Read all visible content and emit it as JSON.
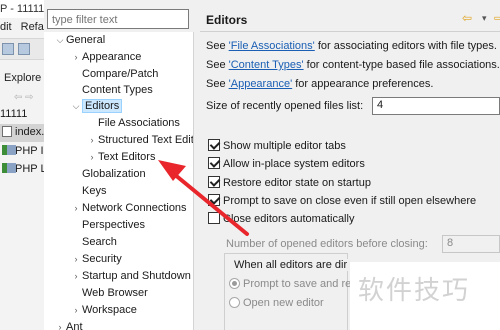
{
  "ide": {
    "title_fragment": "P - 11111",
    "menu": [
      "dit",
      "Refa"
    ],
    "explorer_tab": "Explore",
    "project": "11111",
    "files": [
      "index.",
      "PHP In",
      "PHP L"
    ]
  },
  "preferences": {
    "filter_placeholder": "type filter text",
    "tree": {
      "ant": "Ant",
      "general": "General",
      "general_children": [
        {
          "label": "Appearance",
          "expandable": true
        },
        {
          "label": "Compare/Patch",
          "expandable": false
        },
        {
          "label": "Content Types",
          "expandable": false
        },
        {
          "label": "Editors",
          "expandable": true,
          "expanded": true,
          "selected": true
        },
        {
          "label": "Globalization",
          "expandable": false
        },
        {
          "label": "Keys",
          "expandable": false
        },
        {
          "label": "Network Connections",
          "expandable": true
        },
        {
          "label": "Perspectives",
          "expandable": false
        },
        {
          "label": "Search",
          "expandable": false
        },
        {
          "label": "Security",
          "expandable": true
        },
        {
          "label": "Startup and Shutdown",
          "expandable": true
        },
        {
          "label": "Web Browser",
          "expandable": false
        },
        {
          "label": "Workspace",
          "expandable": true
        }
      ],
      "editors_children": [
        {
          "label": "File Associations",
          "expandable": false
        },
        {
          "label": "Structured Text Editors",
          "expandable": true
        },
        {
          "label": "Text Editors",
          "expandable": true
        }
      ]
    },
    "page": {
      "title": "Editors",
      "see_lines": [
        {
          "prefix": "See ",
          "link": "'File Associations'",
          "suffix": " for associating editors with file types."
        },
        {
          "prefix": "See ",
          "link": "'Content Types'",
          "suffix": " for content-type based file associations."
        },
        {
          "prefix": "See ",
          "link": "'Appearance'",
          "suffix": " for appearance preferences."
        }
      ],
      "recent_files_label": "Size of recently opened files list:",
      "recent_files_value": "4",
      "checkboxes": [
        {
          "label": "Show multiple editor tabs",
          "checked": true
        },
        {
          "label": "Allow in-place system editors",
          "checked": true
        },
        {
          "label": "Restore editor state on startup",
          "checked": true
        },
        {
          "label": "Prompt to save on close even if still open elsewhere",
          "checked": true
        },
        {
          "label": "Close editors automatically",
          "checked": false
        }
      ],
      "opened_editors_label": "Number of opened editors before closing:",
      "opened_editors_value": "8",
      "group_title": "When all editors are dir",
      "radios": [
        {
          "label": "Prompt to save and re",
          "selected": true
        },
        {
          "label": "Open new editor",
          "selected": false
        }
      ]
    }
  },
  "watermark": "软件技巧",
  "colors": {
    "link": "#1a5fb4",
    "selection": "#cce8ff",
    "annotation_arrow": "#e8262c"
  }
}
